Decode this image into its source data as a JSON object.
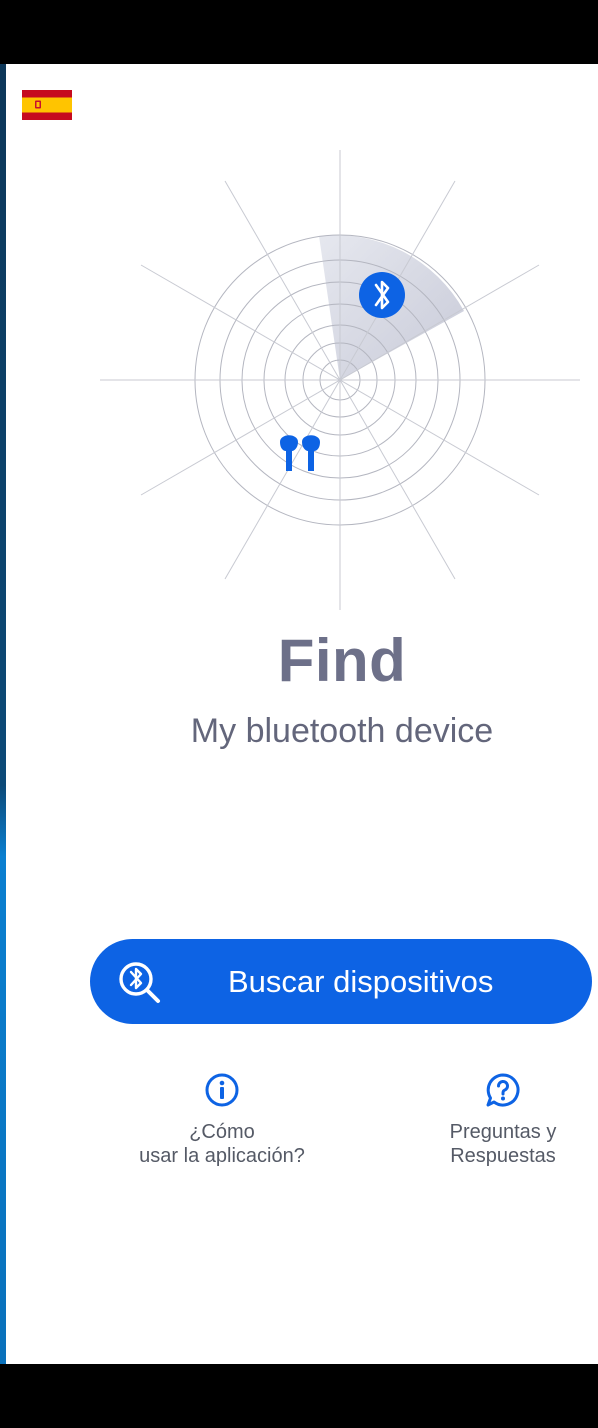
{
  "app": {
    "language_flag_icon": "spain-flag-icon",
    "title": "Find",
    "subtitle": "My bluetooth device"
  },
  "radar": {
    "bluetooth_icon": "bluetooth-icon",
    "earbuds_icon": "earbuds-icon"
  },
  "search_button": {
    "label": "Buscar dispositivos",
    "icon": "bluetooth-search-icon"
  },
  "help": {
    "how_to": {
      "line1": "¿Cómo",
      "line2": "usar la aplicación?",
      "icon": "info-icon"
    },
    "faq": {
      "line1": "Preguntas y",
      "line2": "Respuestas",
      "icon": "question-chat-icon"
    }
  },
  "colors": {
    "accent": "#0d63e4",
    "title": "#6d7089",
    "text": "#555a66"
  }
}
